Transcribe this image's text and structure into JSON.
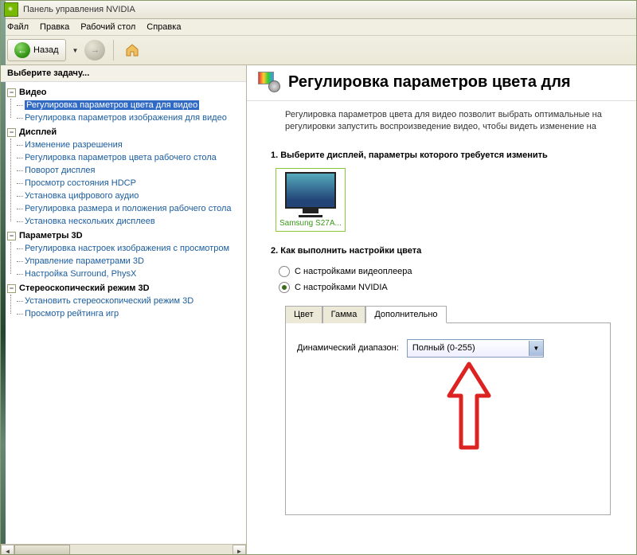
{
  "titlebar": {
    "title": "Панель управления NVIDIA"
  },
  "menu": {
    "file": "Файл",
    "edit": "Правка",
    "desktop": "Рабочий стол",
    "help": "Справка"
  },
  "toolbar": {
    "back": "Назад"
  },
  "sidebar": {
    "header": "Выберите задачу...",
    "groups": [
      {
        "label": "Видео",
        "items": [
          "Регулировка параметров цвета для видео",
          "Регулировка параметров изображения для видео"
        ]
      },
      {
        "label": "Дисплей",
        "items": [
          "Изменение разрешения",
          "Регулировка параметров цвета рабочего стола",
          "Поворот дисплея",
          "Просмотр состояния HDCP",
          "Установка цифрового аудио",
          "Регулировка размера и положения рабочего стола",
          "Установка нескольких дисплеев"
        ]
      },
      {
        "label": "Параметры 3D",
        "items": [
          "Регулировка настроек изображения с просмотром",
          "Управление параметрами 3D",
          "Настройка Surround, PhysX"
        ]
      },
      {
        "label": "Стереоскопический режим 3D",
        "items": [
          "Установить стереоскопический режим 3D",
          "Просмотр рейтинга игр"
        ]
      }
    ]
  },
  "main": {
    "title": "Регулировка параметров цвета для",
    "desc1": "Регулировка параметров цвета для видео позволит выбрать оптимальные на",
    "desc2": "регулировки запустить воспроизведение видео, чтобы видеть изменение на",
    "section1": "1. Выберите дисплей, параметры которого требуется изменить",
    "display_name": "Samsung S27A...",
    "section2": "2. Как выполнить настройки цвета",
    "radio1": "С настройками видеоплеера",
    "radio2": "С настройками NVIDIA",
    "tabs": {
      "color": "Цвет",
      "gamma": "Гамма",
      "advanced": "Дополнительно"
    },
    "field_label": "Динамический диапазон:",
    "combo_value": "Полный (0-255)"
  }
}
